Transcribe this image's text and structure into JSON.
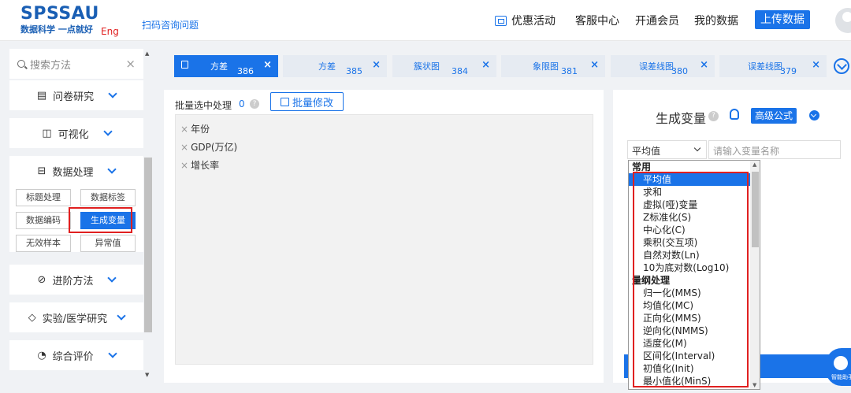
{
  "header": {
    "logo": "SPSSAU",
    "logo_sub": "数据科学 一点就好",
    "logo_eng": "Eng",
    "scan_link": "扫码咨询问题",
    "nav": {
      "promo": "优惠活动",
      "service": "客服中心",
      "member": "开通会员",
      "my_data": "我的数据",
      "upload": "上传数据"
    }
  },
  "sidebar": {
    "search_placeholder": "搜索方法",
    "sections": {
      "questionnaire": "问卷研究",
      "visualization": "可视化",
      "data_processing": "数据处理",
      "advanced": "进阶方法",
      "experiment": "实验/医学研究",
      "evaluation": "综合评价"
    },
    "sub_buttons": [
      "标题处理",
      "数据标签",
      "数据编码",
      "生成变量",
      "无效样本",
      "异常值"
    ]
  },
  "tabs": [
    {
      "title": "方差",
      "num": "386",
      "active": true
    },
    {
      "title": "方差",
      "num": "385"
    },
    {
      "title": "簇状图",
      "num": "384"
    },
    {
      "title": "象限图",
      "num": "381"
    },
    {
      "title": "误差线图",
      "num": "380"
    },
    {
      "title": "误差线图",
      "num": "379"
    }
  ],
  "middle": {
    "batch_label": "批量选中处理",
    "batch_count": "0",
    "batch_edit": "批量修改",
    "variables": [
      "年份",
      "GDP(万亿)",
      "增长率"
    ]
  },
  "right": {
    "title": "生成变量",
    "advanced_formula": "高级公式",
    "select_value": "平均值",
    "var_name_placeholder": "请输入变量名称",
    "help_widget_text": "智能助手"
  },
  "dropdown": {
    "items": [
      {
        "label": "常用",
        "group": true
      },
      {
        "label": "平均值",
        "selected": true
      },
      {
        "label": "求和"
      },
      {
        "label": "虚拟(哑)变量"
      },
      {
        "label": "Z标准化(S)"
      },
      {
        "label": "中心化(C)"
      },
      {
        "label": "乘积(交互项)"
      },
      {
        "label": "自然对数(Ln)"
      },
      {
        "label": "10为底对数(Log10)"
      },
      {
        "label": "量纲处理",
        "group": true
      },
      {
        "label": "归一化(MMS)"
      },
      {
        "label": "均值化(MC)"
      },
      {
        "label": "正向化(MMS)"
      },
      {
        "label": "逆向化(NMMS)"
      },
      {
        "label": "适度化(M)"
      },
      {
        "label": "区间化(Interval)"
      },
      {
        "label": "初值化(Init)"
      },
      {
        "label": "最小值化(MinS)"
      }
    ]
  },
  "colors": {
    "accent": "#1a73e8",
    "highlight": "#e02020",
    "brand": "#1a5fb4"
  }
}
